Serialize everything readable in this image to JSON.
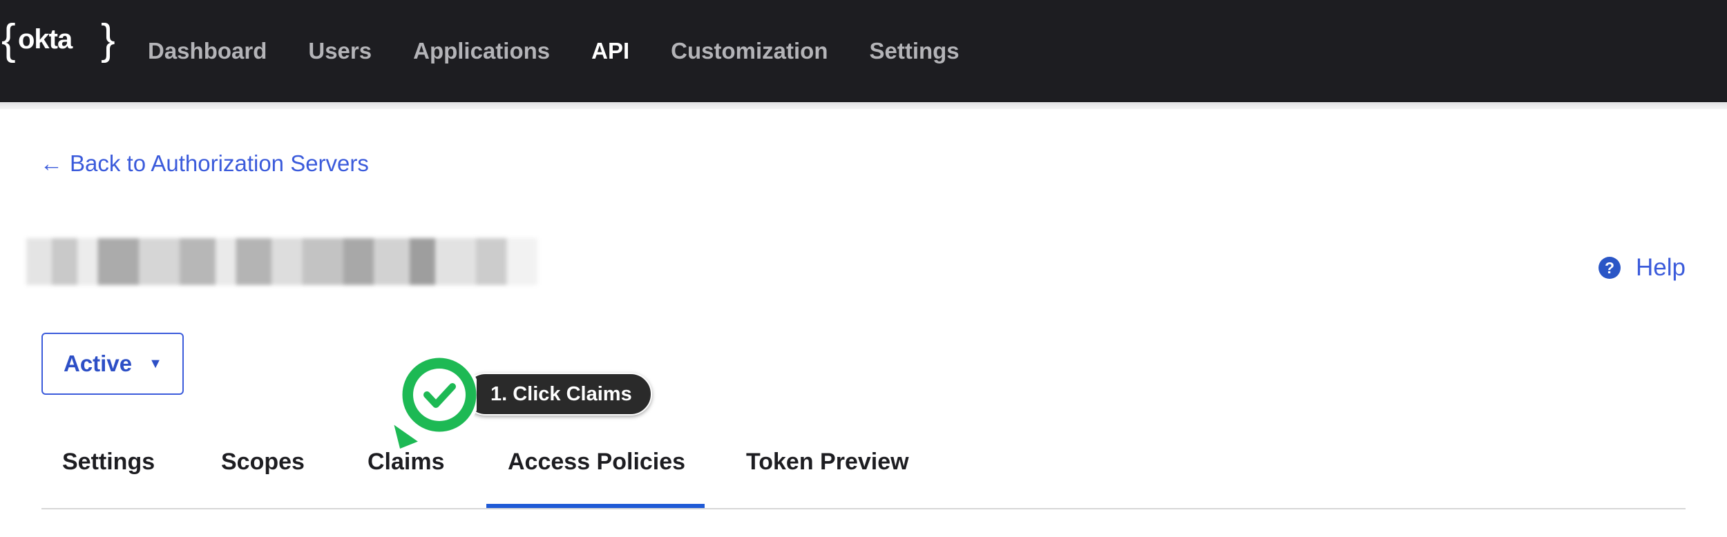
{
  "header": {
    "logo_text": "okta",
    "brace_left": "{",
    "brace_right": "}",
    "nav": [
      {
        "label": "Dashboard",
        "active": false
      },
      {
        "label": "Users",
        "active": false
      },
      {
        "label": "Applications",
        "active": false
      },
      {
        "label": "API",
        "active": true
      },
      {
        "label": "Customization",
        "active": false
      },
      {
        "label": "Settings",
        "active": false
      }
    ]
  },
  "back_link": {
    "arrow": "←",
    "label": "Back to Authorization Servers"
  },
  "help": {
    "icon_glyph": "?",
    "label": "Help"
  },
  "status_dropdown": {
    "value": "Active",
    "caret": "▼"
  },
  "tabs": [
    {
      "label": "Settings",
      "active": false
    },
    {
      "label": "Scopes",
      "active": false
    },
    {
      "label": "Claims",
      "active": false
    },
    {
      "label": "Access Policies",
      "active": true
    },
    {
      "label": "Token Preview",
      "active": false
    }
  ],
  "callout": {
    "text": "1. Click Claims",
    "icon": "check-icon"
  },
  "colors": {
    "header_bg": "#1d1d21",
    "link": "#3b5bdb",
    "tab_active_underline": "#1f5ad6",
    "callout_green": "#1db954"
  }
}
